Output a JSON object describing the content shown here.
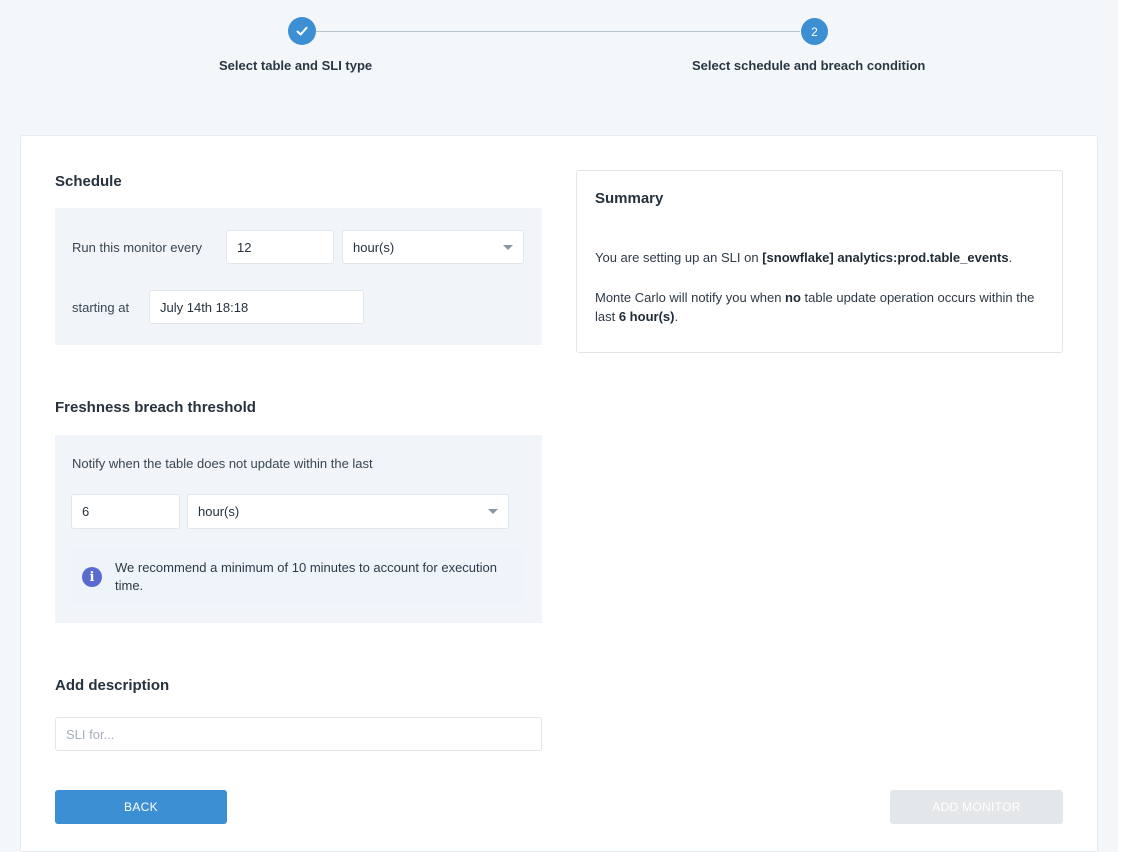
{
  "stepper": {
    "step1": {
      "label": "Select table and SLI type",
      "status": "completed"
    },
    "step2": {
      "number": "2",
      "label": "Select schedule and breach condition"
    }
  },
  "schedule": {
    "title": "Schedule",
    "run_label": "Run this monitor every",
    "interval_value": "12",
    "interval_unit": "hour(s)",
    "starting_label": "starting at",
    "starting_value": "July 14th 18:18"
  },
  "freshness": {
    "title": "Freshness breach threshold",
    "notify_label": "Notify when the table does not update within the last",
    "threshold_value": "6",
    "threshold_unit": "hour(s)",
    "info_text": "We recommend a minimum of 10 minutes to account for execution time."
  },
  "description": {
    "title": "Add description",
    "placeholder": "SLI for..."
  },
  "summary": {
    "title": "Summary",
    "line1_prefix": "You are setting up an SLI on ",
    "line1_table": "[snowflake] analytics:prod.table_events",
    "line1_suffix": ".",
    "line2_prefix": "Monte Carlo will notify you when ",
    "line2_bold_no": "no",
    "line2_middle": " table update operation occurs within the last ",
    "line2_bold_threshold": "6 hour(s)",
    "line2_suffix": "."
  },
  "buttons": {
    "back": "BACK",
    "add_monitor": "ADD MONITOR"
  },
  "colors": {
    "primary": "#3d8fd4",
    "disabled": "#e4e7ea",
    "info_icon": "#5a6bcf"
  }
}
